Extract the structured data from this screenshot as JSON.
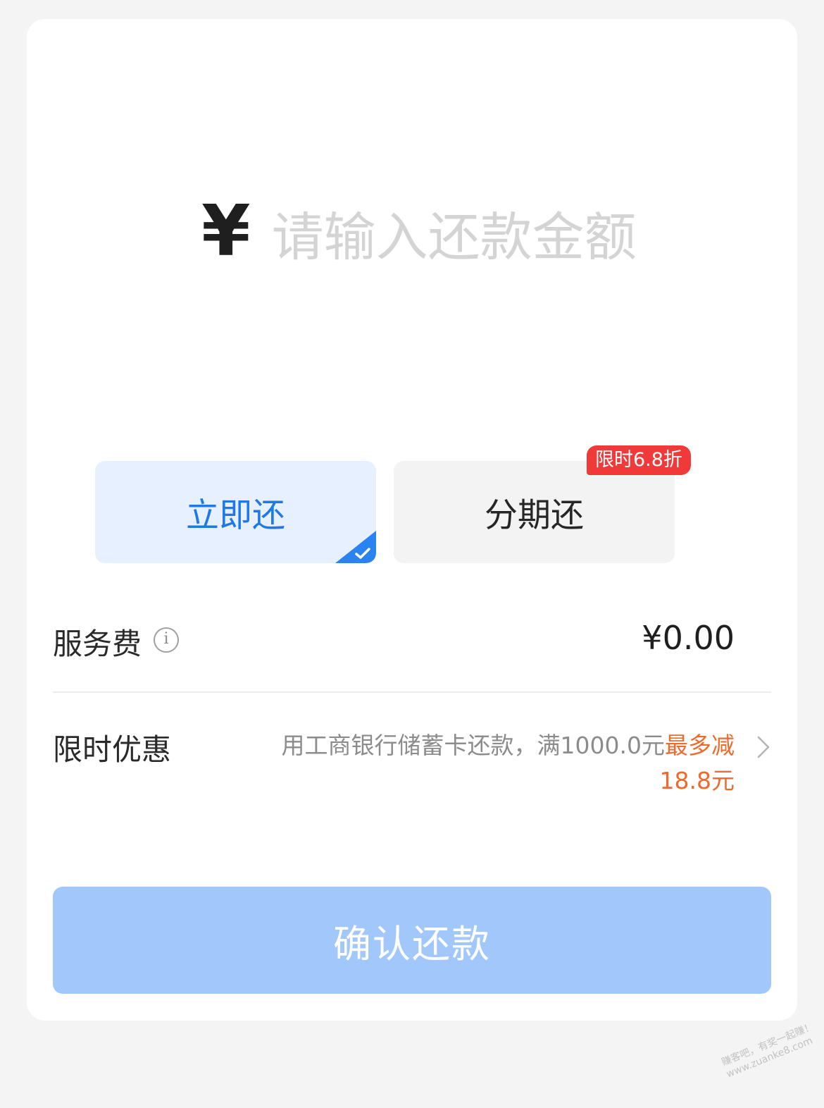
{
  "amount": {
    "currency_symbol": "¥",
    "placeholder": "请输入还款金额",
    "value": ""
  },
  "modes": {
    "now_label": "立即还",
    "installment_label": "分期还",
    "selected": "now",
    "installment_badge": "限时6.8折"
  },
  "fee": {
    "label": "服务费",
    "info_icon": "i",
    "value": "¥0.00"
  },
  "discount": {
    "label": "限时优惠",
    "desc_prefix": "用工商银行储蓄卡还款，满1000.0元",
    "desc_highlight": "最多减18.8元"
  },
  "confirm": {
    "label": "确认还款"
  },
  "watermark": {
    "line1": "赚客吧，有奖一起赚！",
    "line2": "www.zuanke8.com"
  },
  "colors": {
    "accent": "#1e78e6",
    "badge": "#f03a3a",
    "highlight": "#ee6a2d",
    "confirm_disabled": "#a2c7fb"
  }
}
